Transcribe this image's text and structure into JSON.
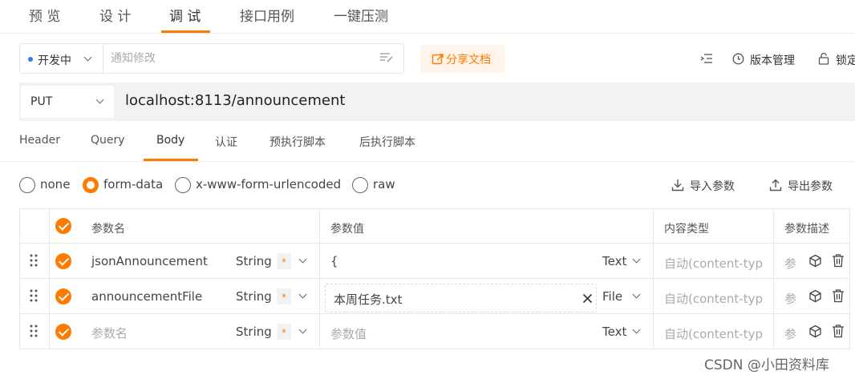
{
  "top_tabs": [
    "预 览",
    "设 计",
    "调 试",
    "接口用例",
    "一键压测"
  ],
  "toolbar": {
    "status": "开发中",
    "note_placeholder": "通知修改",
    "share_label": "分享文档",
    "version_label": "版本管理",
    "lock_label": "锁定"
  },
  "request": {
    "method": "PUT",
    "url": "localhost:8113/announcement"
  },
  "body_tabs": [
    "Header",
    "Query",
    "Body",
    "认证",
    "预执行脚本",
    "后执行脚本"
  ],
  "body_types": [
    "none",
    "form-data",
    "x-www-form-urlencoded",
    "raw"
  ],
  "selected_body_type": "form-data",
  "actions": {
    "import": "导入参数",
    "export": "导出参数"
  },
  "table": {
    "headers": {
      "name": "参数名",
      "value": "参数值",
      "content_type": "内容类型",
      "desc": "参数描述"
    },
    "rows": [
      {
        "name": "jsonAnnouncement",
        "type": "String",
        "required": "*",
        "value": "{",
        "kind": "Text",
        "content_type": "自动(content-typ",
        "desc": "参"
      },
      {
        "name": "announcementFile",
        "type": "String",
        "required": "*",
        "value": "本周任务.txt",
        "kind": "File",
        "content_type": "自动(content-typ",
        "desc": "参"
      },
      {
        "name": "参数名",
        "type": "String",
        "required": "*",
        "value": "参数值",
        "kind": "Text",
        "content_type": "自动(content-typ",
        "desc": "参"
      }
    ]
  },
  "colors": {
    "accent": "#ff7a00",
    "status_dot": "#2f7cf6"
  },
  "watermark": "CSDN @小田资料库"
}
